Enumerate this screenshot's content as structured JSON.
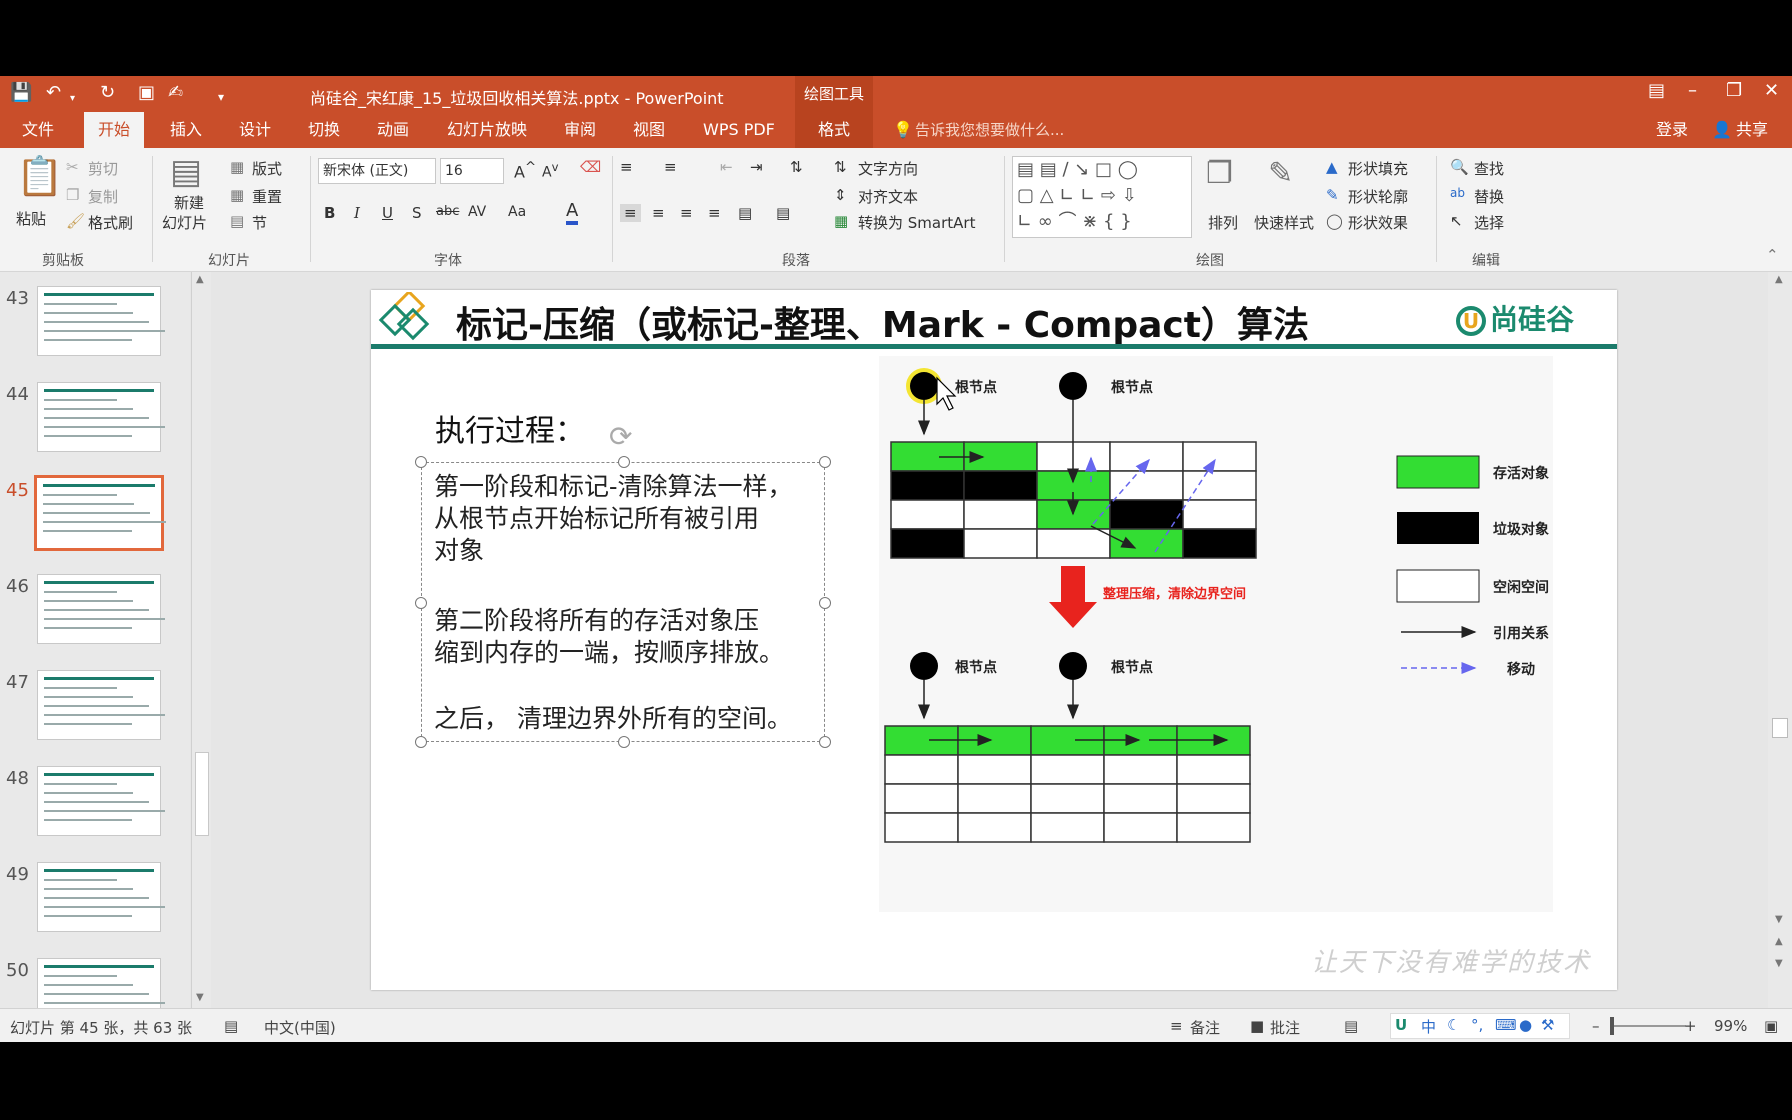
{
  "window": {
    "title": "尚硅谷_宋红康_15_垃圾回收相关算法.pptx - PowerPoint",
    "tool_context": "绘图工具"
  },
  "tabs": [
    "文件",
    "开始",
    "插入",
    "设计",
    "切换",
    "动画",
    "幻灯片放映",
    "审阅",
    "视图",
    "WPS PDF",
    "格式"
  ],
  "tell_me": "告诉我您想要做什么...",
  "account": {
    "login": "登录",
    "share": "共享"
  },
  "ribbon": {
    "clipboard": {
      "paste": "粘贴",
      "cut": "剪切",
      "copy": "复制",
      "painter": "格式刷",
      "label": "剪贴板"
    },
    "slides": {
      "new": "新建",
      "new2": "幻灯片",
      "layout": "版式",
      "reset": "重置",
      "section": "节",
      "label": "幻灯片"
    },
    "font": {
      "name": "新宋体 (正文)",
      "size": "16",
      "label": "字体"
    },
    "paragraph": {
      "text_dir": "文字方向",
      "align_text": "对齐文本",
      "smartart": "转换为 SmartArt",
      "label": "段落"
    },
    "drawing": {
      "arrange": "排列",
      "quick_styles": "快速样式",
      "fill": "形状填充",
      "outline": "形状轮廓",
      "effects": "形状效果",
      "label": "绘图"
    },
    "editing": {
      "find": "查找",
      "replace": "替换",
      "select": "选择",
      "label": "编辑"
    }
  },
  "thumbnails": [
    {
      "num": "43",
      "selected": false
    },
    {
      "num": "44",
      "selected": false
    },
    {
      "num": "45",
      "selected": true
    },
    {
      "num": "46",
      "selected": false
    },
    {
      "num": "47",
      "selected": false
    },
    {
      "num": "48",
      "selected": false
    },
    {
      "num": "49",
      "selected": false
    },
    {
      "num": "50",
      "selected": false
    }
  ],
  "slide": {
    "title": "标记-压缩（或标记-整理、Mark - Compact）算法",
    "brand": "尚硅谷",
    "exec_label": "执行过程：",
    "para1": [
      "第一阶段和标记-清除算法一样，",
      "从根节点开始标记所有被引用",
      "对象"
    ],
    "para2": [
      "第二阶段将所有的存活对象压",
      "缩到内存的一端，按顺序排放。"
    ],
    "para3": "之后， 清理边界外所有的空间。",
    "watermark": "让天下没有难学的技术",
    "diagram": {
      "root_label": "根节点",
      "compress_label": "整理压缩，清除边界空间",
      "legend": [
        "存活对象",
        "垃圾对象",
        "空闲空间",
        "引用关系",
        "移动"
      ],
      "colors": {
        "alive": "#33dd33",
        "garbage": "#000000",
        "free": "#ffffff",
        "arrow": "#e8231e",
        "move": "#6666ee"
      },
      "before_grid": [
        [
          "alive",
          "alive",
          "free",
          "free",
          "free"
        ],
        [
          "garbage",
          "garbage",
          "alive",
          "free",
          "free"
        ],
        [
          "free",
          "free",
          "alive",
          "garbage",
          "free"
        ],
        [
          "garbage",
          "free",
          "free",
          "alive",
          "garbage"
        ]
      ],
      "after_grid": [
        [
          "alive",
          "alive",
          "alive",
          "alive",
          "alive"
        ],
        [
          "free",
          "free",
          "free",
          "free",
          "free"
        ],
        [
          "free",
          "free",
          "free",
          "free",
          "free"
        ],
        [
          "free",
          "free",
          "free",
          "free",
          "free"
        ]
      ]
    }
  },
  "status": {
    "slide_info": "幻灯片 第 45 张，共 63 张",
    "language": "中文(中国)",
    "notes": "备注",
    "comments": "批注",
    "zoom": "99%",
    "ime": "中"
  }
}
